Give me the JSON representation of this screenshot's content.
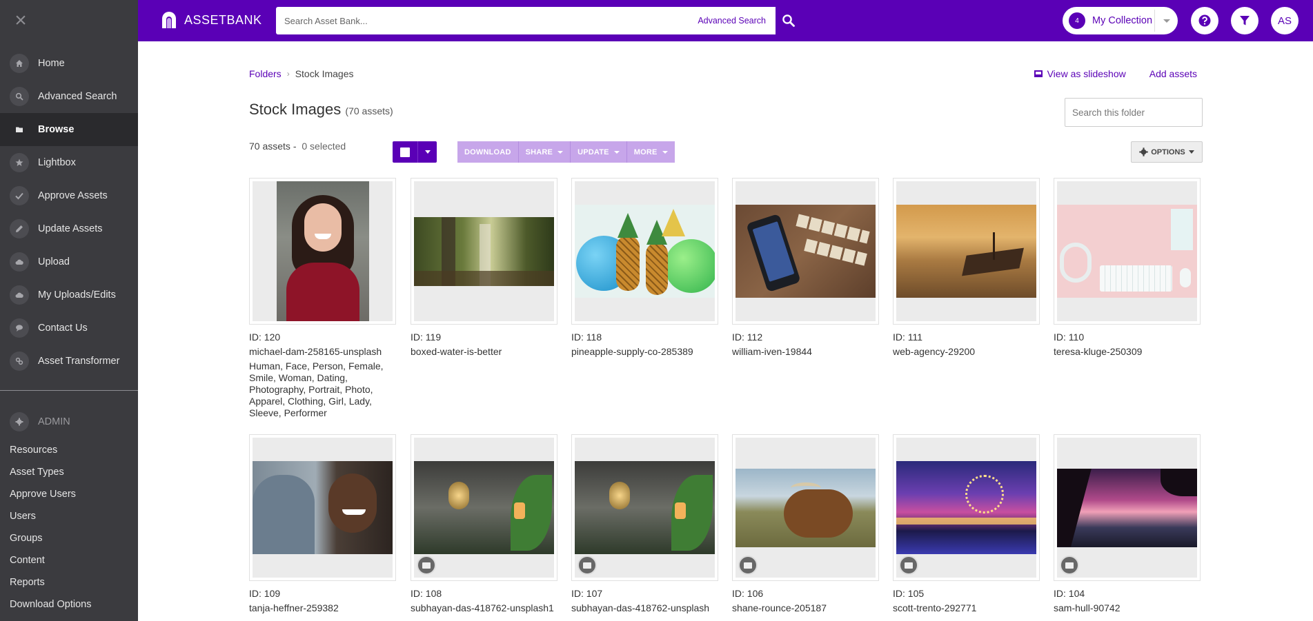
{
  "sidebar": {
    "nav": [
      {
        "label": "Home",
        "icon": "home-icon"
      },
      {
        "label": "Advanced Search",
        "icon": "search-icon"
      },
      {
        "label": "Browse",
        "icon": "folder-icon",
        "active": true
      },
      {
        "label": "Lightbox",
        "icon": "star-icon"
      },
      {
        "label": "Approve Assets",
        "icon": "check-icon"
      },
      {
        "label": "Update Assets",
        "icon": "pencil-icon"
      },
      {
        "label": "Upload",
        "icon": "cloud-upload-icon"
      },
      {
        "label": "My Uploads/Edits",
        "icon": "cloud-icon"
      },
      {
        "label": "Contact Us",
        "icon": "chat-icon"
      },
      {
        "label": "Asset Transformer",
        "icon": "link-icon"
      }
    ],
    "admin_title": "ADMIN",
    "admin_links": [
      "Resources",
      "Asset Types",
      "Approve Users",
      "Users",
      "Groups",
      "Content",
      "Reports",
      "Download Options"
    ]
  },
  "topbar": {
    "logo_text": "ASSETBANK",
    "search_placeholder": "Search Asset Bank...",
    "advanced_search": "Advanced Search",
    "collection_count": "4",
    "collection_label": "My Collection",
    "avatar_initials": "AS",
    "brand_color": "#5a00b6"
  },
  "main": {
    "breadcrumb": {
      "parent": "Folders",
      "current": "Stock Images"
    },
    "view_slideshow": "View as slideshow",
    "add_assets": "Add assets",
    "title": "Stock Images",
    "title_count": "(70 assets)",
    "folder_search_placeholder": "Search this folder",
    "asset_count": "70 assets -",
    "selected_count": "0 selected",
    "bulk_actions": [
      "DOWNLOAD",
      "SHARE",
      "UPDATE",
      "MORE"
    ],
    "options_label": "OPTIONS"
  },
  "assets": [
    {
      "id": "ID: 120",
      "name": "michael-dam-258165-unsplash",
      "tags": "Human, Face, Person, Female, Smile, Woman, Dating, Photography, Portrait, Photo, Apparel, Clothing, Girl, Lady, Sleeve, Performer",
      "video": false
    },
    {
      "id": "ID: 119",
      "name": "boxed-water-is-better",
      "tags": "",
      "video": false
    },
    {
      "id": "ID: 118",
      "name": "pineapple-supply-co-285389",
      "tags": "",
      "video": false
    },
    {
      "id": "ID: 112",
      "name": "william-iven-19844",
      "tags": "",
      "video": false
    },
    {
      "id": "ID: 111",
      "name": "web-agency-29200",
      "tags": "",
      "video": false
    },
    {
      "id": "ID: 110",
      "name": "teresa-kluge-250309",
      "tags": "",
      "video": false
    },
    {
      "id": "ID: 109",
      "name": "tanja-heffner-259382",
      "tags": "",
      "video": false
    },
    {
      "id": "ID: 108",
      "name": "subhayan-das-418762-unsplash1",
      "tags": "",
      "video": true
    },
    {
      "id": "ID: 107",
      "name": "subhayan-das-418762-unsplash",
      "tags": "",
      "video": true
    },
    {
      "id": "ID: 106",
      "name": "shane-rounce-205187",
      "tags": "",
      "video": true
    },
    {
      "id": "ID: 105",
      "name": "scott-trento-292771",
      "tags": "",
      "video": true
    },
    {
      "id": "ID: 104",
      "name": "sam-hull-90742",
      "tags": "",
      "video": true
    }
  ]
}
